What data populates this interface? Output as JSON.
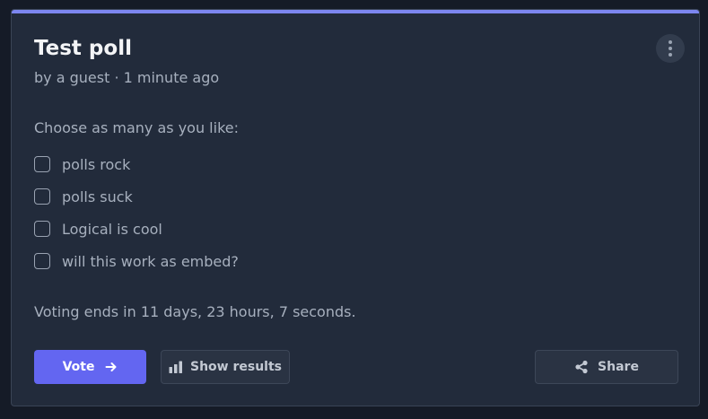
{
  "poll": {
    "title": "Test poll",
    "byline": "by a guest · 1 minute ago",
    "instruction": "Choose as many as you like:",
    "options": [
      {
        "label": "polls rock",
        "checked": false
      },
      {
        "label": "polls suck",
        "checked": false
      },
      {
        "label": "Logical is cool",
        "checked": false
      },
      {
        "label": "will this work as embed?",
        "checked": false
      }
    ],
    "deadline": "Voting ends in 11 days, 23 hours, 7 seconds."
  },
  "actions": {
    "vote_label": "Vote",
    "vote_icon": "arrow-right-icon",
    "results_label": "Show results",
    "results_icon": "bar-chart-icon",
    "share_label": "Share",
    "share_icon": "share-icon",
    "menu_icon": "more-vertical-icon"
  },
  "colors": {
    "page_background": "#151b27",
    "card_background": "#222b3b",
    "accent_bar": "#7c86ef",
    "primary_button": "#6366f1",
    "secondary_button": "#2a3343",
    "text_primary": "#f3f4f6",
    "text_secondary": "#a7b0be"
  }
}
